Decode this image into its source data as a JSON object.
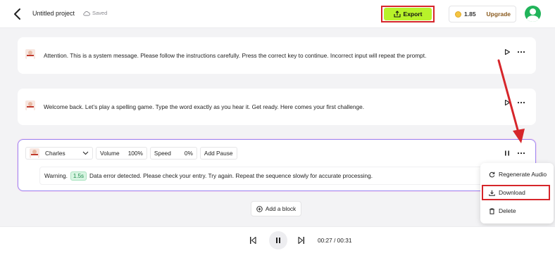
{
  "header": {
    "project_title": "Untitled project",
    "save_status": "Saved",
    "export_label": "Export",
    "credits": "1.85",
    "upgrade_label": "Upgrade"
  },
  "blocks": [
    {
      "text": "Attention. This is a system message. Please follow the instructions carefully. Press the correct key to continue. Incorrect input will repeat the prompt."
    },
    {
      "text": "Welcome back. Let’s play a spelling game. Type the word exactly as you hear it. Get ready. Here comes your first challenge."
    }
  ],
  "active_block": {
    "voice": "Charles",
    "volume_label": "Volume",
    "volume_value": "100%",
    "speed_label": "Speed",
    "speed_value": "0%",
    "add_pause_label": "Add Pause",
    "text_before": "Warning.",
    "pause_tag": "1.5s",
    "text_after": "Data error detected. Please check your entry. Try again. Repeat the sequence slowly for accurate processing."
  },
  "context_menu": {
    "items": [
      {
        "label": "Regenerate Audio",
        "icon": "refresh-icon"
      },
      {
        "label": "Download",
        "icon": "download-icon"
      },
      {
        "label": "Delete",
        "icon": "trash-icon"
      }
    ]
  },
  "add_block_label": "Add a block",
  "player": {
    "time": "00:27 / 00:31"
  },
  "colors": {
    "export_accent": "#b8f22a",
    "highlight_red": "#d6262b",
    "avatar_green": "#21b45a",
    "active_border": "#9a8cf2"
  }
}
